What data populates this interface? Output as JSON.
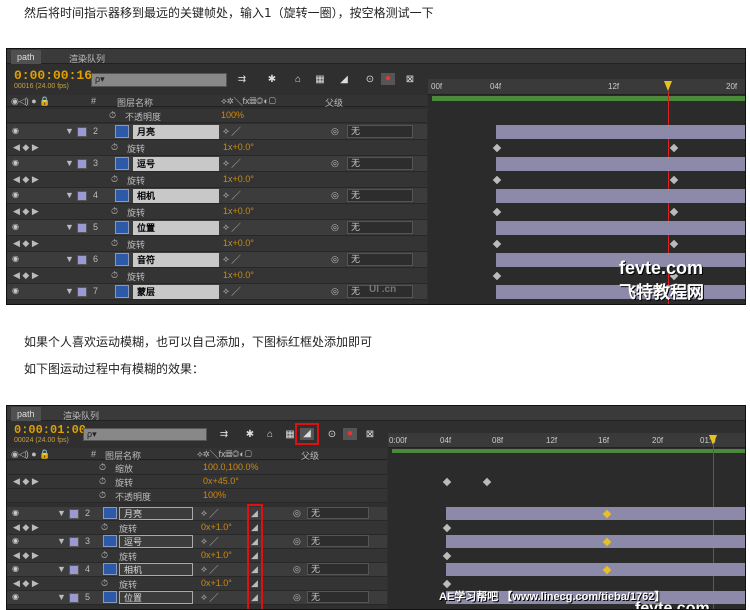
{
  "intro_text": "然后将时间指示器移到最远的关键帧处，输入1（旋转一圈），按空格测试一下",
  "mid_text_1": "如果个人喜欢运动模糊，也可以自己添加，下图标红框处添加即可",
  "mid_text_2": "如下图运动过程中有模糊的效果：",
  "panel1": {
    "tabs": [
      "path",
      "渲染队列"
    ],
    "timecode": "0:00:00:16",
    "fps": "00016 (24.00 fps)",
    "search_placeholder": "ρ▾",
    "header": {
      "col_num": "#",
      "col_name": "图层名称",
      "col_parent": "父级"
    },
    "opacity_label": "不透明度",
    "opacity_value": "100%",
    "ruler": [
      "00f",
      "04f",
      "12f",
      "20f"
    ],
    "layers": [
      {
        "num": "2",
        "name": "月亮",
        "parent": "无",
        "prop": "旋转",
        "prop_value": "1x+0.0°"
      },
      {
        "num": "3",
        "name": "逗号",
        "parent": "无",
        "prop": "旋转",
        "prop_value": "1x+0.0°"
      },
      {
        "num": "4",
        "name": "相机",
        "parent": "无",
        "prop": "旋转",
        "prop_value": "1x+0.0°"
      },
      {
        "num": "5",
        "name": "位置",
        "parent": "无",
        "prop": "旋转",
        "prop_value": "1x+0.0°"
      },
      {
        "num": "6",
        "name": "音符",
        "parent": "无",
        "prop": "旋转",
        "prop_value": "1x+0.0°"
      },
      {
        "num": "7",
        "name": "蒙层",
        "parent": "无"
      }
    ],
    "watermark_small": "UI .cn",
    "watermark_1": "fevte.com",
    "watermark_2": "飞特教程网"
  },
  "panel2": {
    "tabs": [
      "path",
      "渲染队列"
    ],
    "timecode": "0:00:01:00",
    "fps": "00024 (24.00 fps)",
    "search_placeholder": "ρ▾",
    "header": {
      "col_num": "#",
      "col_name": "图层名称",
      "col_parent": "父级"
    },
    "ruler": [
      "0:00f",
      "04f",
      "08f",
      "12f",
      "16f",
      "20f",
      "01:0"
    ],
    "top_rows": [
      {
        "label": "缩放",
        "value": "100.0,100.0%"
      },
      {
        "label": "旋转",
        "value": "0x+45.0°"
      },
      {
        "label": "不透明度",
        "value": "100%"
      }
    ],
    "layers": [
      {
        "num": "2",
        "name": "月亮",
        "parent": "无",
        "prop": "旋转",
        "prop_value": "0x+1.0°"
      },
      {
        "num": "3",
        "name": "逗号",
        "parent": "无",
        "prop": "旋转",
        "prop_value": "0x+1.0°"
      },
      {
        "num": "4",
        "name": "相机",
        "parent": "无",
        "prop": "旋转",
        "prop_value": "0x+1.0°"
      },
      {
        "num": "5",
        "name": "位置",
        "parent": "无"
      }
    ],
    "watermark_bar": "AE学习帮吧  【www.linecg.com/tieba/1762】",
    "watermark_1": "fevte.com"
  },
  "colors": {
    "accent_timecode": "#e0a000",
    "playhead": "#dd2222",
    "highlight_box": "#e01010",
    "bar": "#8c8aa8"
  }
}
